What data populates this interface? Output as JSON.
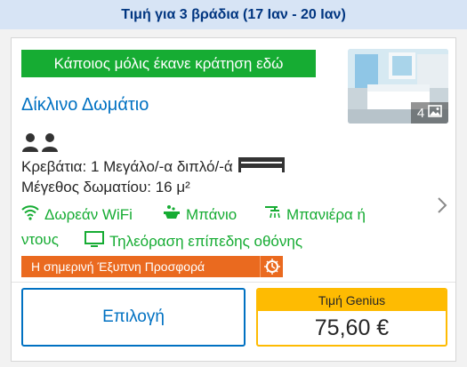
{
  "header": {
    "title": "Τιμή για 3 βράδια (17 Ιαν - 20 Ιαν)"
  },
  "room": {
    "recent_booking": "Κάποιος μόλις έκανε κράτηση εδώ",
    "title": "Δίκλινο Δωμάτιο",
    "photo_count": "4",
    "beds": "Κρεβάτια: 1 Μεγάλο/-α διπλό/-ά",
    "size": "Μέγεθος δωματίου: 16 μ²",
    "amenities": {
      "wifi": "Δωρεάν WiFi",
      "bath": "Μπάνιο",
      "shower": "Μπανιέρα ή",
      "shower_cont": "ντους",
      "tv": "Τηλεόραση επίπεδης οθόνης"
    },
    "deal": "Η σημερινή Έξυπνη Προσφορά"
  },
  "actions": {
    "select_label": "Επιλογή",
    "price_label": "Τιμή Genius",
    "price": "75,60 €"
  },
  "colors": {
    "brand_blue": "#0071c2",
    "header_bg": "#d7e4f5",
    "green": "#16ac33",
    "deal_orange": "#ea6a1f",
    "genius_yellow": "#febb02"
  },
  "icons": [
    "guests-icon",
    "double-bed-icon",
    "wifi-icon",
    "bath-icon",
    "shower-icon",
    "tv-icon",
    "deal-clock-icon",
    "photo-icon",
    "chevron-right-icon"
  ]
}
